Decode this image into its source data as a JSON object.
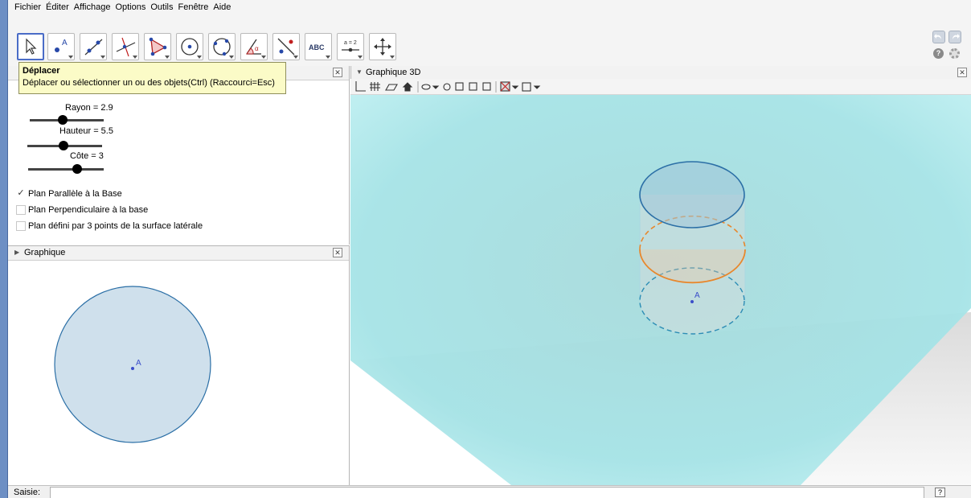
{
  "menu": {
    "items": [
      "Fichier",
      "Éditer",
      "Affichage",
      "Options",
      "Outils",
      "Fenêtre",
      "Aide"
    ]
  },
  "toolbar": {
    "tools": [
      {
        "name": "move-tool-button",
        "icon": "cursor-arrow-icon"
      },
      {
        "name": "point-tool-button",
        "icon": "point-A-icon"
      },
      {
        "name": "line-tool-button",
        "icon": "line-icon"
      },
      {
        "name": "perpendicular-tool-button",
        "icon": "perpendicular-line-icon"
      },
      {
        "name": "polygon-tool-button",
        "icon": "polygon-icon"
      },
      {
        "name": "circle-tool-button",
        "icon": "circle-center-icon"
      },
      {
        "name": "circle-three-points-tool-button",
        "icon": "circle-three-points-icon"
      },
      {
        "name": "angle-tool-button",
        "icon": "angle-icon"
      },
      {
        "name": "reflect-tool-button",
        "icon": "reflect-line-icon"
      },
      {
        "name": "text-tool-button",
        "icon": "text-ABC-icon",
        "label": "ABC"
      },
      {
        "name": "slider-tool-button",
        "icon": "slider-icon",
        "label": "a = 2"
      },
      {
        "name": "move-graphics-tool-button",
        "icon": "move-view-icon"
      }
    ]
  },
  "tooltip": {
    "title": "Déplacer",
    "text": "Déplacer ou sélectionner un ou des objets(Ctrl) (Raccourci=Esc)"
  },
  "algebra": {
    "sliders": [
      {
        "label": "Rayon = 2.9",
        "value": 2.9
      },
      {
        "label": "Hauteur = 5.5",
        "value": 5.5
      },
      {
        "label": "Côte = 3",
        "value": 3
      }
    ],
    "checkboxes": [
      {
        "label": "Plan Parallèle à la Base",
        "checked": true
      },
      {
        "label": "Plan Perpendiculaire à la base",
        "checked": false
      },
      {
        "label": "Plan défini par 3 points de la surface latérale",
        "checked": false
      }
    ]
  },
  "graphics": {
    "title": "Graphique",
    "point_label": "A"
  },
  "graphics3d": {
    "title": "Graphique 3D",
    "point_label": "A"
  },
  "inputbar": {
    "label": "Saisie:",
    "value": "",
    "help": "?"
  },
  "colors": {
    "accent": "#4a6cc7",
    "plane": "#a8e4e6",
    "circle_fill": "#cfe0ec",
    "circle_stroke": "#2b6fa6",
    "section": "#e8872c",
    "point": "#3a4dc9"
  }
}
